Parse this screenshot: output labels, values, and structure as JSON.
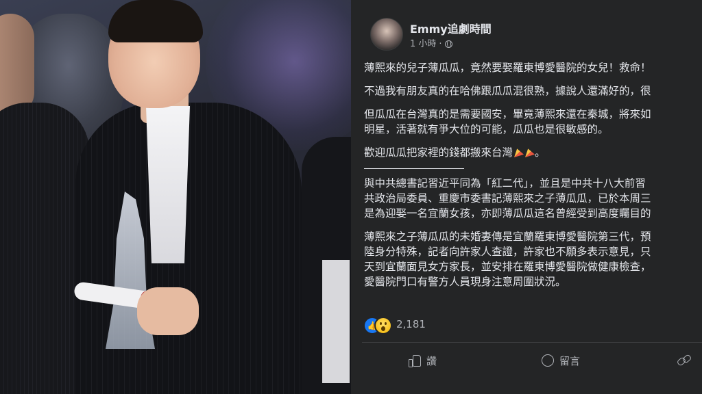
{
  "post": {
    "author": "Emmy追劇時間",
    "time": "1 小時",
    "separator": "·",
    "paragraphs": [
      "薄熙來的兒子薄瓜瓜，竟然要娶羅東博愛醫院的女兒！救命！",
      "不過我有朋友真的在哈佛跟瓜瓜混很熟，據說人還滿好的，很",
      "但瓜瓜在台灣真的是需要國安，畢竟薄熙來還在秦城，將來如\n明星，活著就有爭大位的可能，瓜瓜也是很敏感的。",
      "歡迎瓜瓜把家裡的錢都搬來台灣",
      "與中共總書記習近平同為「紅二代」，並且是中共十八大前習\n共政治局委員、重慶市委書記薄熙來之子薄瓜瓜，已於本周三\n是為迎娶一名宜蘭女孩，亦即薄瓜瓜這名曾經受到高度矚目的",
      "薄熙來之子薄瓜瓜的未婚妻傳是宜蘭羅東博愛醫院第三代，預\n陸身分特殊，記者向許家人查證，許家也不願多表示意見，只\n天到宜蘭面見女方家長，並安排在羅東博愛醫院做健康檢查，\n愛醫院門口有警方人員現身注意周圍狀況。"
    ],
    "paragraph4_suffix": "。",
    "reaction_count": "2,181",
    "actions": {
      "like": "讚",
      "comment": "留言"
    }
  },
  "icons": {
    "globe": "globe-icon",
    "like": "thumbs-up-icon",
    "wow": "wow-reaction-icon",
    "party": "party-popper-icon",
    "comment": "comment-icon",
    "share": "share-icon"
  },
  "colors": {
    "panel_bg": "#242526",
    "text_primary": "#e4e6eb",
    "text_secondary": "#b0b3b8",
    "like_blue": "#1877f2"
  }
}
